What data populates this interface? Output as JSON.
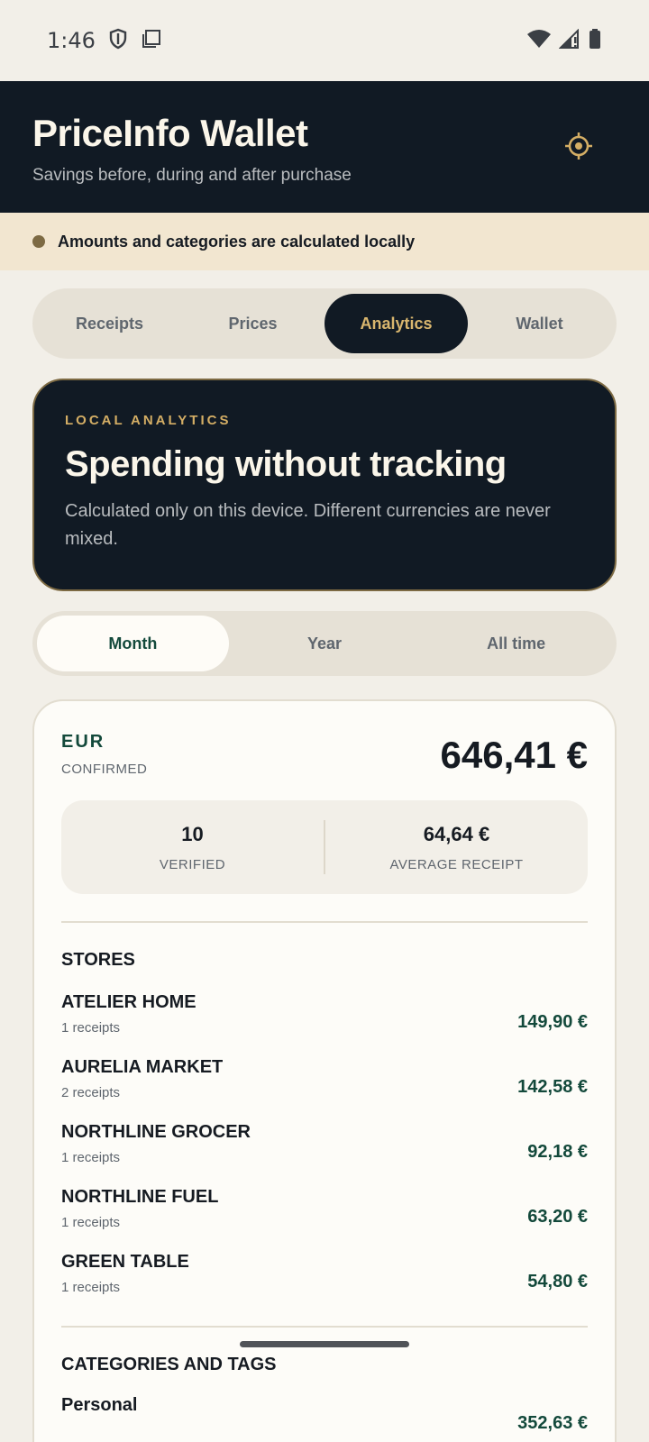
{
  "status_bar": {
    "time": "1:46"
  },
  "header": {
    "title": "PriceInfo Wallet",
    "subtitle": "Savings before, during and after purchase"
  },
  "banner": {
    "text": "Amounts and categories are calculated locally"
  },
  "tabs": [
    {
      "label": "Receipts",
      "active": false
    },
    {
      "label": "Prices",
      "active": false
    },
    {
      "label": "Analytics",
      "active": true
    },
    {
      "label": "Wallet",
      "active": false
    }
  ],
  "hero": {
    "kicker": "LOCAL ANALYTICS",
    "title": "Spending without tracking",
    "description": "Calculated only on this device. Different currencies are never mixed."
  },
  "period": [
    {
      "label": "Month",
      "active": true
    },
    {
      "label": "Year",
      "active": false
    },
    {
      "label": "All time",
      "active": false
    }
  ],
  "summary": {
    "currency": "EUR",
    "status": "CONFIRMED",
    "total": "646,41 €",
    "verified_value": "10",
    "verified_label": "VERIFIED",
    "average_value": "64,64 €",
    "average_label": "AVERAGE RECEIPT"
  },
  "stores": {
    "title": "STORES",
    "items": [
      {
        "name": "ATELIER HOME",
        "count": "1 receipts",
        "amount": "149,90 €"
      },
      {
        "name": "AURELIA MARKET",
        "count": "2 receipts",
        "amount": "142,58 €"
      },
      {
        "name": "NORTHLINE GROCER",
        "count": "1 receipts",
        "amount": "92,18 €"
      },
      {
        "name": "NORTHLINE FUEL",
        "count": "1 receipts",
        "amount": "63,20 €"
      },
      {
        "name": "GREEN TABLE",
        "count": "1 receipts",
        "amount": "54,80 €"
      }
    ]
  },
  "categories": {
    "title": "CATEGORIES AND TAGS",
    "items": [
      {
        "name": "Personal",
        "amount": "352,63 €"
      }
    ]
  },
  "colors": {
    "header_bg": "#111a24",
    "accent_gold": "#d4ae65",
    "accent_green": "#13493b",
    "page_bg": "#f2efe8"
  }
}
